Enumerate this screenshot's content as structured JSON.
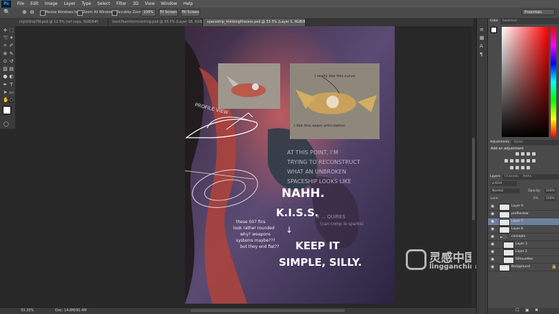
{
  "app": {
    "logo": "Ps"
  },
  "menu": [
    "File",
    "Edit",
    "Image",
    "Layer",
    "Type",
    "Select",
    "Filter",
    "3D",
    "View",
    "Window",
    "Help"
  ],
  "options": {
    "resize_windows": "Resize Windows to Fit",
    "zoom_all_windows": "Zoom All Windows",
    "scrubby_zoom": "Scrubby Zoom",
    "btn_100": "100%",
    "btn_fit": "Fit Screen",
    "btn_fill": "Fill Screen",
    "workspace": "Essentials"
  },
  "tabs": [
    {
      "label": "nightShipTW.psd @ 12.5% (ref copy, RGB/8#)"
    },
    {
      "label": "bankTeamformconting.psd @ 33.3% (Layer 18, RGB/8)"
    },
    {
      "label": "spaceship_thinkingProcess.psd @ 33.3% (Layer 5, RGB/8#)"
    }
  ],
  "status": {
    "zoom": "33.33%",
    "doc": "Doc: 14.8M/91.4M"
  },
  "color_panel": {
    "tabs": [
      "Color",
      "Swatches"
    ]
  },
  "adjustments_panel": {
    "tabs": [
      "Adjustments",
      "Styles"
    ],
    "heading": "Add an adjustment"
  },
  "layers_panel": {
    "tabs": [
      "Layers",
      "Channels",
      "Paths"
    ],
    "kind": "ρ Kind",
    "blend": "Normal",
    "opacity_label": "Opacity:",
    "opacity": "100%",
    "lock_label": "Lock:",
    "fill_label": "Fill:",
    "fill": "100%",
    "layers": [
      {
        "name": "Layer 9",
        "selected": false
      },
      {
        "name": "profileview",
        "selected": false
      },
      {
        "name": "Layer 7",
        "selected": true
      },
      {
        "name": "Layer 8",
        "selected": false
      },
      {
        "name": "concepts",
        "selected": false
      },
      {
        "name": "Layer 3",
        "selected": false
      },
      {
        "name": "Layer 2",
        "selected": false
      },
      {
        "name": "Silhouettes",
        "selected": false
      },
      {
        "name": "Background",
        "selected": false
      }
    ]
  },
  "canvas_notes": {
    "really_like": "I really like this curve",
    "like_seam": "I like this seam articulation",
    "profile_view": "PROFILE VIEW",
    "point_1": "AT THIS POINT, I'M",
    "point_2": "TRYING TO RECONSTRUCT",
    "point_3": "WHAT AN UNBROKEN",
    "point_4": "SPACESHIP LOOKS LIKE",
    "nahh": "NAHH.",
    "kiss": "K.I.S.S.",
    "keep_it": "KEEP IT",
    "simple_silly": "SIMPLE, SILLY.",
    "requires_1": "R    ... QUIRES",
    "requires_2": "(can comp le sparks)",
    "fins_1": "these 007 fins",
    "fins_2": "look rather rounded",
    "fins_3": "why? weapons",
    "fins_4": "systems maybe???",
    "fins_5": "but they end flat??"
  },
  "watermark": {
    "cn": "灵感中国",
    "url": "lingganchina.com"
  },
  "colors": {
    "accent_selected": "#6d7f9c",
    "ui_dark": "#282828",
    "panel": "#4a4a4a"
  }
}
